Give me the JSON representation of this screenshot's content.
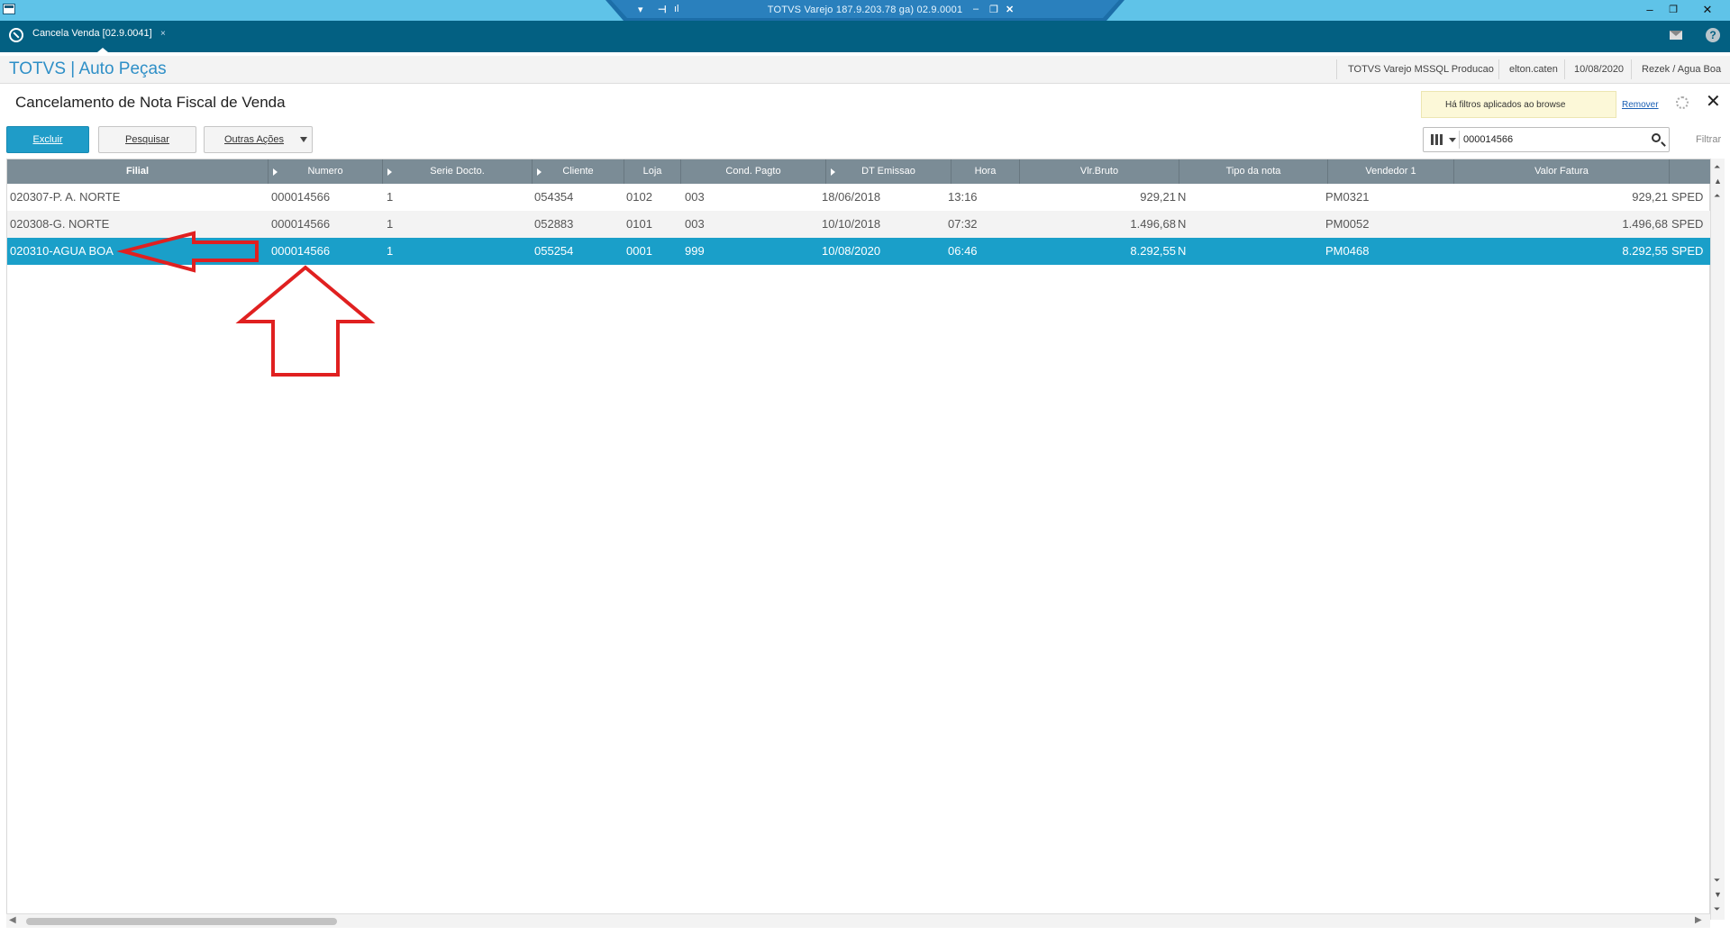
{
  "window": {
    "remote_title": "TOTVS Varejo 187.9.203.78 ga) 02.9.0001"
  },
  "tabbar": {
    "tab_label": "Cancela Venda [02.9.0041]",
    "tab_close": "×"
  },
  "header": {
    "brand": "TOTVS | Auto Peças",
    "environment": "TOTVS Varejo MSSQL Producao",
    "user": "elton.caten",
    "date": "10/08/2020",
    "branch": "Rezek / Agua Boa"
  },
  "page": {
    "title": "Cancelamento de Nota Fiscal de Venda",
    "filter_notice": "Há filtros aplicados ao browse",
    "filter_remove": "Remover"
  },
  "toolbar": {
    "delete_label": "Excluir",
    "search_label": "Pesquisar",
    "more_label": "Outras Ações",
    "search_value": "000014566",
    "filter_label": "Filtrar"
  },
  "grid": {
    "columns": [
      "Filial",
      "Numero",
      "Serie Docto.",
      "Cliente",
      "Loja",
      "Cond. Pagto",
      "DT Emissao",
      "Hora",
      "Vlr.Bruto",
      "Tipo da nota",
      "Vendedor 1",
      "Valor Fatura"
    ],
    "rows": [
      {
        "filial": "020307-P. A. NORTE",
        "numero": "000014566",
        "serie": "1",
        "cliente": "054354",
        "loja": "0102",
        "cond": "003",
        "emissao": "18/06/2018",
        "hora": "13:16",
        "bruto": "929,21",
        "tipo": "N",
        "vendedor": "PM0321",
        "fatura": "929,21",
        "extra": "SPED"
      },
      {
        "filial": "020308-G. NORTE",
        "numero": "000014566",
        "serie": "1",
        "cliente": "052883",
        "loja": "0101",
        "cond": "003",
        "emissao": "10/10/2018",
        "hora": "07:32",
        "bruto": "1.496,68",
        "tipo": "N",
        "vendedor": "PM0052",
        "fatura": "1.496,68",
        "extra": "SPED"
      },
      {
        "filial": "020310-AGUA BOA",
        "numero": "000014566",
        "serie": "1",
        "cliente": "055254",
        "loja": "0001",
        "cond": "999",
        "emissao": "10/08/2020",
        "hora": "06:46",
        "bruto": "8.292,55",
        "tipo": "N",
        "vendedor": "PM0468",
        "fatura": "8.292,55",
        "extra": "SPED"
      }
    ],
    "selected_row": 2
  },
  "colors": {
    "titlebar": "#5fc3e8",
    "tabbar": "#036082",
    "brand": "#2e8fc7",
    "primary_button": "#1f9cc8",
    "selected_row": "#1a9fc9",
    "grid_header": "#7b8c96",
    "annotation": "#e02020"
  }
}
